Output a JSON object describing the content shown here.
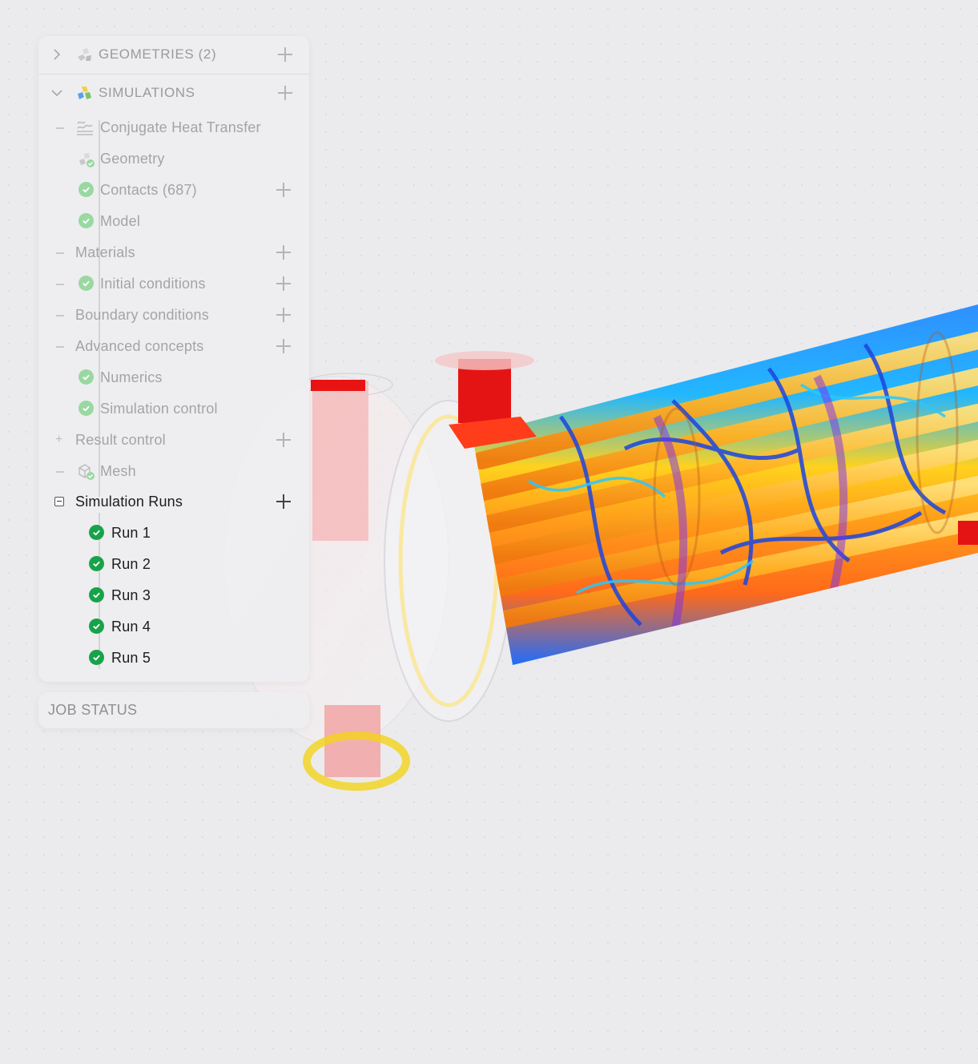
{
  "tree": {
    "geometries": {
      "label": "GEOMETRIES (2)",
      "icon": "geometries-icon",
      "expanded": false
    },
    "simulations": {
      "label": "SIMULATIONS",
      "icon": "simulations-icon",
      "expanded": true,
      "items": [
        {
          "id": "cht",
          "label": "Conjugate Heat Transfer",
          "icon": "heat-transfer-icon",
          "addable": false
        },
        {
          "id": "geometry",
          "label": "Geometry",
          "icon": "geometry-check-icon",
          "addable": false
        },
        {
          "id": "contacts",
          "label": "Contacts (687)",
          "icon": "check-icon",
          "addable": true
        },
        {
          "id": "model",
          "label": "Model",
          "icon": "check-icon",
          "addable": false
        },
        {
          "id": "materials",
          "label": "Materials",
          "icon": "",
          "addable": true
        },
        {
          "id": "initial",
          "label": "Initial conditions",
          "icon": "check-icon",
          "addable": true
        },
        {
          "id": "boundary",
          "label": "Boundary conditions",
          "icon": "",
          "addable": true
        },
        {
          "id": "advanced",
          "label": "Advanced concepts",
          "icon": "",
          "addable": true
        },
        {
          "id": "numerics",
          "label": "Numerics",
          "icon": "check-icon",
          "addable": false
        },
        {
          "id": "simcontrol",
          "label": "Simulation control",
          "icon": "check-icon",
          "addable": false
        },
        {
          "id": "result",
          "label": "Result control",
          "icon": "",
          "addable": true
        },
        {
          "id": "mesh",
          "label": "Mesh",
          "icon": "mesh-check-icon",
          "addable": false
        },
        {
          "id": "runs",
          "label": "Simulation Runs",
          "icon": "",
          "addable": true
        }
      ],
      "runs": [
        "Run 1",
        "Run 2",
        "Run 3",
        "Run 4",
        "Run 5"
      ]
    }
  },
  "job_status": {
    "label": "JOB STATUS"
  },
  "colors": {
    "success": "#17a34a",
    "success_muted": "#9ad8a2",
    "muted_text": "#a4a4a8"
  }
}
